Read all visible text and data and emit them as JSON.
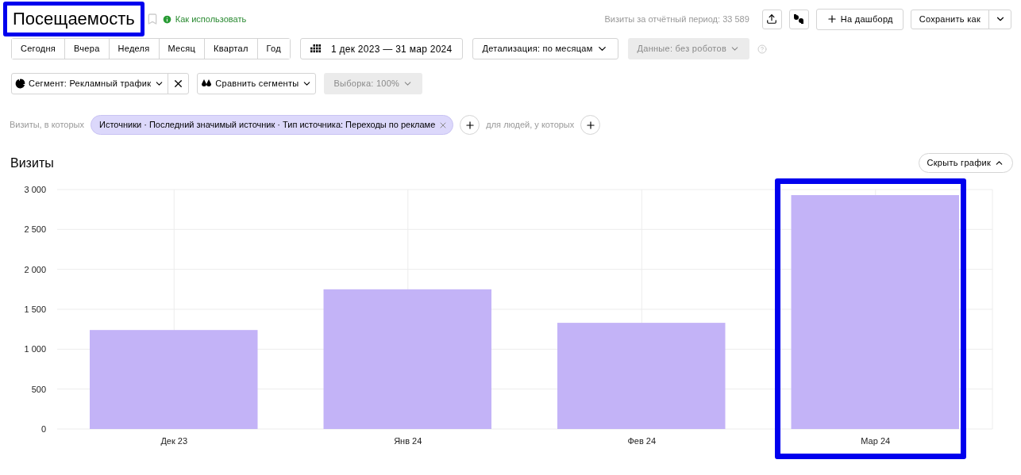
{
  "header": {
    "title": "Посещаемость",
    "title_highlighted": true,
    "help_link": "Как использовать",
    "visits_total": "Визиты за отчётный период: 33 589",
    "dashboard_button": "На дашборд",
    "save_button": "Сохранить как"
  },
  "periods": [
    {
      "label": "Сегодня",
      "selected": false
    },
    {
      "label": "Вчера",
      "selected": false
    },
    {
      "label": "Неделя",
      "selected": false
    },
    {
      "label": "Месяц",
      "selected": false
    },
    {
      "label": "Квартал",
      "selected": false
    },
    {
      "label": "Год",
      "selected": false
    }
  ],
  "date_range": "1 дек 2023 — 31 мар 2024",
  "detail": "Детализация: по месяцам",
  "data_filter": {
    "label": "Данные: без роботов",
    "disabled": true
  },
  "segment": "Сегмент: Рекламный трафик",
  "compare": "Сравнить сегменты",
  "sample": {
    "label": "Выборка: 100%",
    "disabled": true
  },
  "filter_row": {
    "prefix": "Визиты, в которых",
    "chip": "Источники · Последний значимый источник · Тип источника: Переходы по рекламе",
    "people_label": "для людей, у которых"
  },
  "chart": {
    "hide_button": "Скрыть график",
    "chart_data": {
      "type": "bar",
      "categories": [
        "Дек 23",
        "Янв 24",
        "Фев 24",
        "Мар 24"
      ],
      "series": [
        {
          "name": "Визиты",
          "color": "#c3b3f7",
          "values": [
            1240,
            1750,
            1330,
            2930
          ]
        }
      ],
      "ylim": [
        0,
        3000
      ],
      "yticks": [
        {
          "value": 0,
          "label": "0"
        },
        {
          "value": 500,
          "label": "500"
        },
        {
          "value": 1000,
          "label": "1 000"
        },
        {
          "value": 1500,
          "label": "1 500"
        },
        {
          "value": 2000,
          "label": "2 000"
        },
        {
          "value": 2500,
          "label": "2 500"
        },
        {
          "value": 3000,
          "label": "3 000"
        }
      ],
      "grid": true
    },
    "bar_highlights": [
      {
        "highlighted": false
      },
      {
        "highlighted": false
      },
      {
        "highlighted": false
      },
      {
        "highlighted": true
      }
    ]
  }
}
